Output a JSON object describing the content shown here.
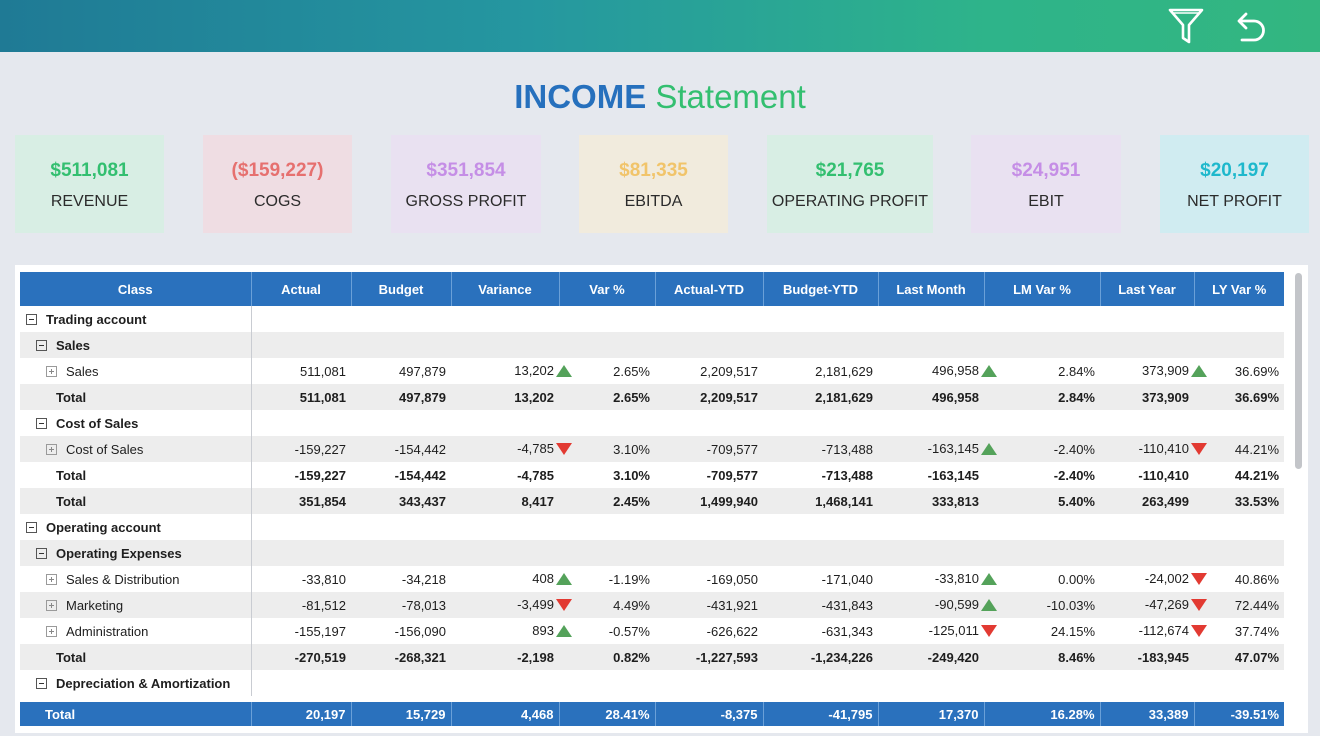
{
  "page": {
    "title_part1": "INCOME",
    "title_part2": "Statement",
    "icons": [
      "filter-icon",
      "undo-icon"
    ]
  },
  "kpis": [
    {
      "value": "$511,081",
      "label": "REVENUE",
      "value_color": "#33bf70",
      "bg": "#d8eee4"
    },
    {
      "value": "($159,227)",
      "label": "COGS",
      "value_color": "#e6706f",
      "bg": "#efdde3"
    },
    {
      "value": "$351,854",
      "label": "GROSS PROFIT",
      "value_color": "#c58ee6",
      "bg": "#e9e1f1"
    },
    {
      "value": "$81,335",
      "label": "EBITDA",
      "value_color": "#f1c46a",
      "bg": "#f1ebdd"
    },
    {
      "value": "$21,765",
      "label": "OPERATING PROFIT",
      "value_color": "#33bf70",
      "bg": "#d8eee4"
    },
    {
      "value": "$24,951",
      "label": "EBIT",
      "value_color": "#c58ee6",
      "bg": "#e9e1f1"
    },
    {
      "value": "$20,197",
      "label": "NET PROFIT",
      "value_color": "#1eb8cc",
      "bg": "#d0ecf1"
    }
  ],
  "table": {
    "headers": [
      "Class",
      "Actual",
      "Budget",
      "Variance",
      "Var %",
      "Actual-YTD",
      "Budget-YTD",
      "Last Month",
      "LM Var %",
      "Last Year",
      "LY Var %"
    ],
    "rows": [
      {
        "label": "Trading account",
        "level": 0,
        "expander": "minus",
        "bold": true,
        "shade": false,
        "cells": [
          "",
          "",
          "",
          "",
          "",
          "",
          "",
          "",
          "",
          ""
        ]
      },
      {
        "label": "Sales",
        "level": 1,
        "expander": "minus",
        "bold": true,
        "shade": true,
        "cells": [
          "",
          "",
          "",
          "",
          "",
          "",
          "",
          "",
          "",
          ""
        ]
      },
      {
        "label": "Sales",
        "level": 2,
        "expander": "plus",
        "bold": false,
        "shade": false,
        "cells": [
          "511,081",
          "497,879",
          "13,202",
          "2.65%",
          "2,209,517",
          "2,181,629",
          "496,958",
          "2.84%",
          "373,909",
          "36.69%"
        ],
        "var_icon": "up",
        "lm_icon": "up",
        "ly_icon": "up"
      },
      {
        "label": "Total",
        "level": 1,
        "expander": "",
        "bold": true,
        "shade": true,
        "cells": [
          "511,081",
          "497,879",
          "13,202",
          "2.65%",
          "2,209,517",
          "2,181,629",
          "496,958",
          "2.84%",
          "373,909",
          "36.69%"
        ]
      },
      {
        "label": "Cost of Sales",
        "level": 1,
        "expander": "minus",
        "bold": true,
        "shade": false,
        "cells": [
          "",
          "",
          "",
          "",
          "",
          "",
          "",
          "",
          "",
          ""
        ]
      },
      {
        "label": "Cost of Sales",
        "level": 2,
        "expander": "plus",
        "bold": false,
        "shade": true,
        "cells": [
          "-159,227",
          "-154,442",
          "-4,785",
          "3.10%",
          "-709,577",
          "-713,488",
          "-163,145",
          "-2.40%",
          "-110,410",
          "44.21%"
        ],
        "var_icon": "down",
        "lm_icon": "up",
        "ly_icon": "down"
      },
      {
        "label": "Total",
        "level": 1,
        "expander": "",
        "bold": true,
        "shade": false,
        "cells": [
          "-159,227",
          "-154,442",
          "-4,785",
          "3.10%",
          "-709,577",
          "-713,488",
          "-163,145",
          "-2.40%",
          "-110,410",
          "44.21%"
        ]
      },
      {
        "label": "Total",
        "level": 0,
        "expander": "",
        "bold": true,
        "shade": true,
        "cells": [
          "351,854",
          "343,437",
          "8,417",
          "2.45%",
          "1,499,940",
          "1,468,141",
          "333,813",
          "5.40%",
          "263,499",
          "33.53%"
        ]
      },
      {
        "label": "Operating account",
        "level": 0,
        "expander": "minus",
        "bold": true,
        "shade": false,
        "cells": [
          "",
          "",
          "",
          "",
          "",
          "",
          "",
          "",
          "",
          ""
        ]
      },
      {
        "label": "Operating Expenses",
        "level": 1,
        "expander": "minus",
        "bold": true,
        "shade": true,
        "cells": [
          "",
          "",
          "",
          "",
          "",
          "",
          "",
          "",
          "",
          ""
        ]
      },
      {
        "label": "Sales & Distribution",
        "level": 2,
        "expander": "plus",
        "bold": false,
        "shade": false,
        "cells": [
          "-33,810",
          "-34,218",
          "408",
          "-1.19%",
          "-169,050",
          "-171,040",
          "-33,810",
          "0.00%",
          "-24,002",
          "40.86%"
        ],
        "var_icon": "up",
        "lm_icon": "up",
        "ly_icon": "down"
      },
      {
        "label": "Marketing",
        "level": 2,
        "expander": "plus",
        "bold": false,
        "shade": true,
        "cells": [
          "-81,512",
          "-78,013",
          "-3,499",
          "4.49%",
          "-431,921",
          "-431,843",
          "-90,599",
          "-10.03%",
          "-47,269",
          "72.44%"
        ],
        "var_icon": "down",
        "lm_icon": "up",
        "ly_icon": "down"
      },
      {
        "label": "Administration",
        "level": 2,
        "expander": "plus",
        "bold": false,
        "shade": false,
        "cells": [
          "-155,197",
          "-156,090",
          "893",
          "-0.57%",
          "-626,622",
          "-631,343",
          "-125,011",
          "24.15%",
          "-112,674",
          "37.74%"
        ],
        "var_icon": "up",
        "lm_icon": "down",
        "ly_icon": "down"
      },
      {
        "label": "Total",
        "level": 1,
        "expander": "",
        "bold": true,
        "shade": true,
        "cells": [
          "-270,519",
          "-268,321",
          "-2,198",
          "0.82%",
          "-1,227,593",
          "-1,234,226",
          "-249,420",
          "8.46%",
          "-183,945",
          "47.07%"
        ]
      },
      {
        "label": "Depreciation & Amortization",
        "level": 1,
        "expander": "minus",
        "bold": true,
        "shade": false,
        "cells": [
          "",
          "",
          "",
          "",
          "",
          "",
          "",
          "",
          "",
          ""
        ]
      }
    ],
    "grand_total": {
      "label": "Total",
      "cells": [
        "20,197",
        "15,729",
        "4,468",
        "28.41%",
        "-8,375",
        "-41,795",
        "17,370",
        "16.28%",
        "33,389",
        "-39.51%"
      ]
    }
  }
}
